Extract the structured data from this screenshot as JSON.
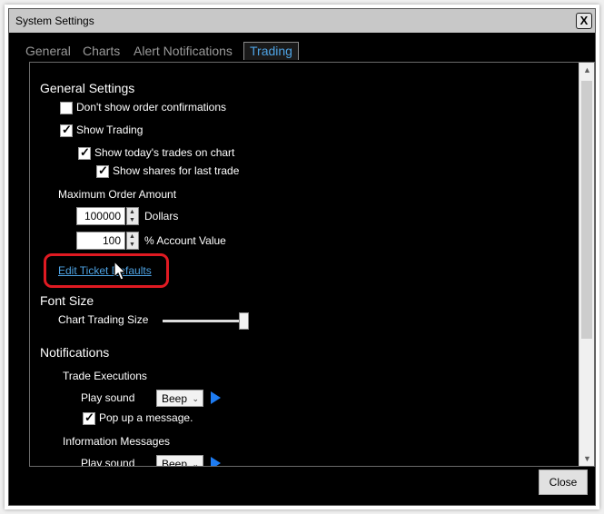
{
  "window": {
    "title": "System Settings",
    "close_glyph": "X"
  },
  "tabs": [
    {
      "label": "General",
      "active": false
    },
    {
      "label": "Charts",
      "active": false
    },
    {
      "label": "Alert Notifications",
      "active": false
    },
    {
      "label": "Trading",
      "active": true
    }
  ],
  "general": {
    "heading": "General Settings",
    "dont_show_confirmations": {
      "label": "Don't show order confirmations",
      "checked": false
    },
    "show_trading": {
      "label": "Show Trading",
      "checked": true
    },
    "show_todays_trades": {
      "label": "Show today's trades on chart",
      "checked": true
    },
    "show_shares": {
      "label": "Show shares for last trade",
      "checked": true
    },
    "max_order_label": "Maximum Order Amount",
    "dollars_value": "100000",
    "dollars_label": "Dollars",
    "percent_value": "100",
    "percent_label": "% Account Value",
    "edit_link": "Edit Ticket Defaults"
  },
  "font_size": {
    "heading": "Font Size",
    "chart_trading_size_label": "Chart Trading Size",
    "slider_level": 1.0
  },
  "notifications": {
    "heading": "Notifications",
    "trade_executions": {
      "label": "Trade Executions",
      "play_sound_label": "Play sound",
      "sound": "Beep",
      "popup": {
        "label": "Pop up a message.",
        "checked": true
      }
    },
    "information_messages": {
      "label": "Information Messages",
      "play_sound_label": "Play sound",
      "sound": "Beep"
    }
  },
  "footer": {
    "close_label": "Close"
  },
  "colors": {
    "link": "#4ea3e4",
    "highlight": "#e01a22",
    "play": "#1e7cf2"
  },
  "icons": {
    "check": "check-icon",
    "play": "play-icon",
    "chevron": "chevron-down-icon",
    "cursor": "mouse-cursor-icon"
  }
}
